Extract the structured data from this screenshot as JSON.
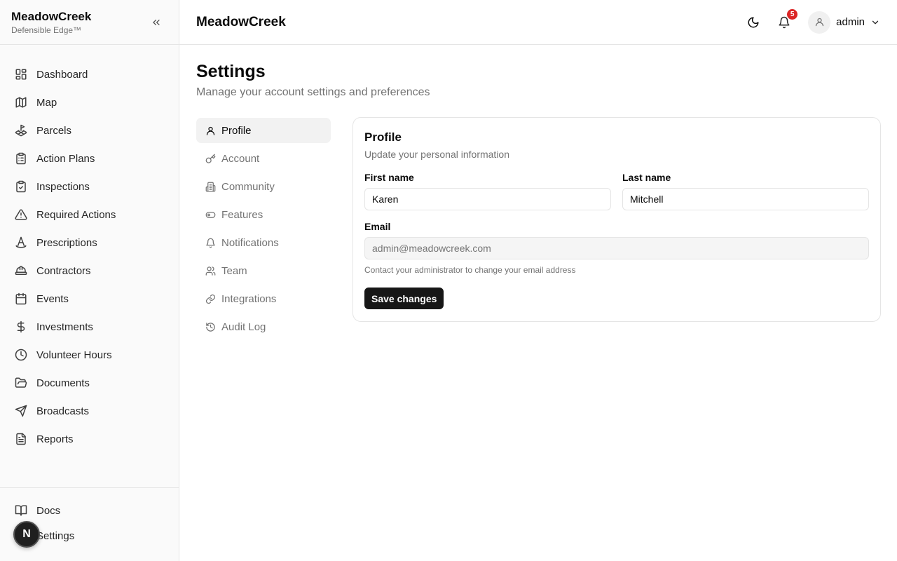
{
  "brand": {
    "name": "MeadowCreek",
    "tagline": "Defensible Edge™"
  },
  "sidebar": {
    "items": [
      {
        "label": "Dashboard",
        "icon": "layout-grid-icon"
      },
      {
        "label": "Map",
        "icon": "map-icon"
      },
      {
        "label": "Parcels",
        "icon": "land-plot-icon"
      },
      {
        "label": "Action Plans",
        "icon": "clipboard-list-icon"
      },
      {
        "label": "Inspections",
        "icon": "clipboard-check-icon"
      },
      {
        "label": "Required Actions",
        "icon": "alert-triangle-icon"
      },
      {
        "label": "Prescriptions",
        "icon": "cone-icon"
      },
      {
        "label": "Contractors",
        "icon": "hard-hat-icon"
      },
      {
        "label": "Events",
        "icon": "calendar-icon"
      },
      {
        "label": "Investments",
        "icon": "dollar-icon"
      },
      {
        "label": "Volunteer Hours",
        "icon": "clock-icon"
      },
      {
        "label": "Documents",
        "icon": "folder-open-icon"
      },
      {
        "label": "Broadcasts",
        "icon": "send-icon"
      },
      {
        "label": "Reports",
        "icon": "file-text-icon"
      }
    ],
    "bottom": [
      {
        "label": "Docs",
        "icon": "book-open-icon"
      },
      {
        "label": "Settings",
        "icon": "settings-icon"
      }
    ],
    "floating_badge": "N"
  },
  "header": {
    "title": "MeadowCreek",
    "notification_count": "5",
    "user": "admin"
  },
  "page": {
    "title": "Settings",
    "subtitle": "Manage your account settings and preferences"
  },
  "settings_nav": [
    {
      "label": "Profile",
      "icon": "user-icon",
      "active": true
    },
    {
      "label": "Account",
      "icon": "key-icon"
    },
    {
      "label": "Community",
      "icon": "building-icon"
    },
    {
      "label": "Features",
      "icon": "toggle-icon"
    },
    {
      "label": "Notifications",
      "icon": "bell-icon"
    },
    {
      "label": "Team",
      "icon": "users-icon"
    },
    {
      "label": "Integrations",
      "icon": "link-icon"
    },
    {
      "label": "Audit Log",
      "icon": "history-icon"
    }
  ],
  "profile": {
    "title": "Profile",
    "description": "Update your personal information",
    "first_name_label": "First name",
    "first_name": "Karen",
    "last_name_label": "Last name",
    "last_name": "Mitchell",
    "email_label": "Email",
    "email_placeholder": "admin@meadowcreek.com",
    "email_hint": "Contact your administrator to change your email address",
    "save_label": "Save changes"
  },
  "colors": {
    "primary": "#171717",
    "badge": "#dc2626",
    "muted_text": "#737373",
    "border": "#e5e5e5"
  }
}
